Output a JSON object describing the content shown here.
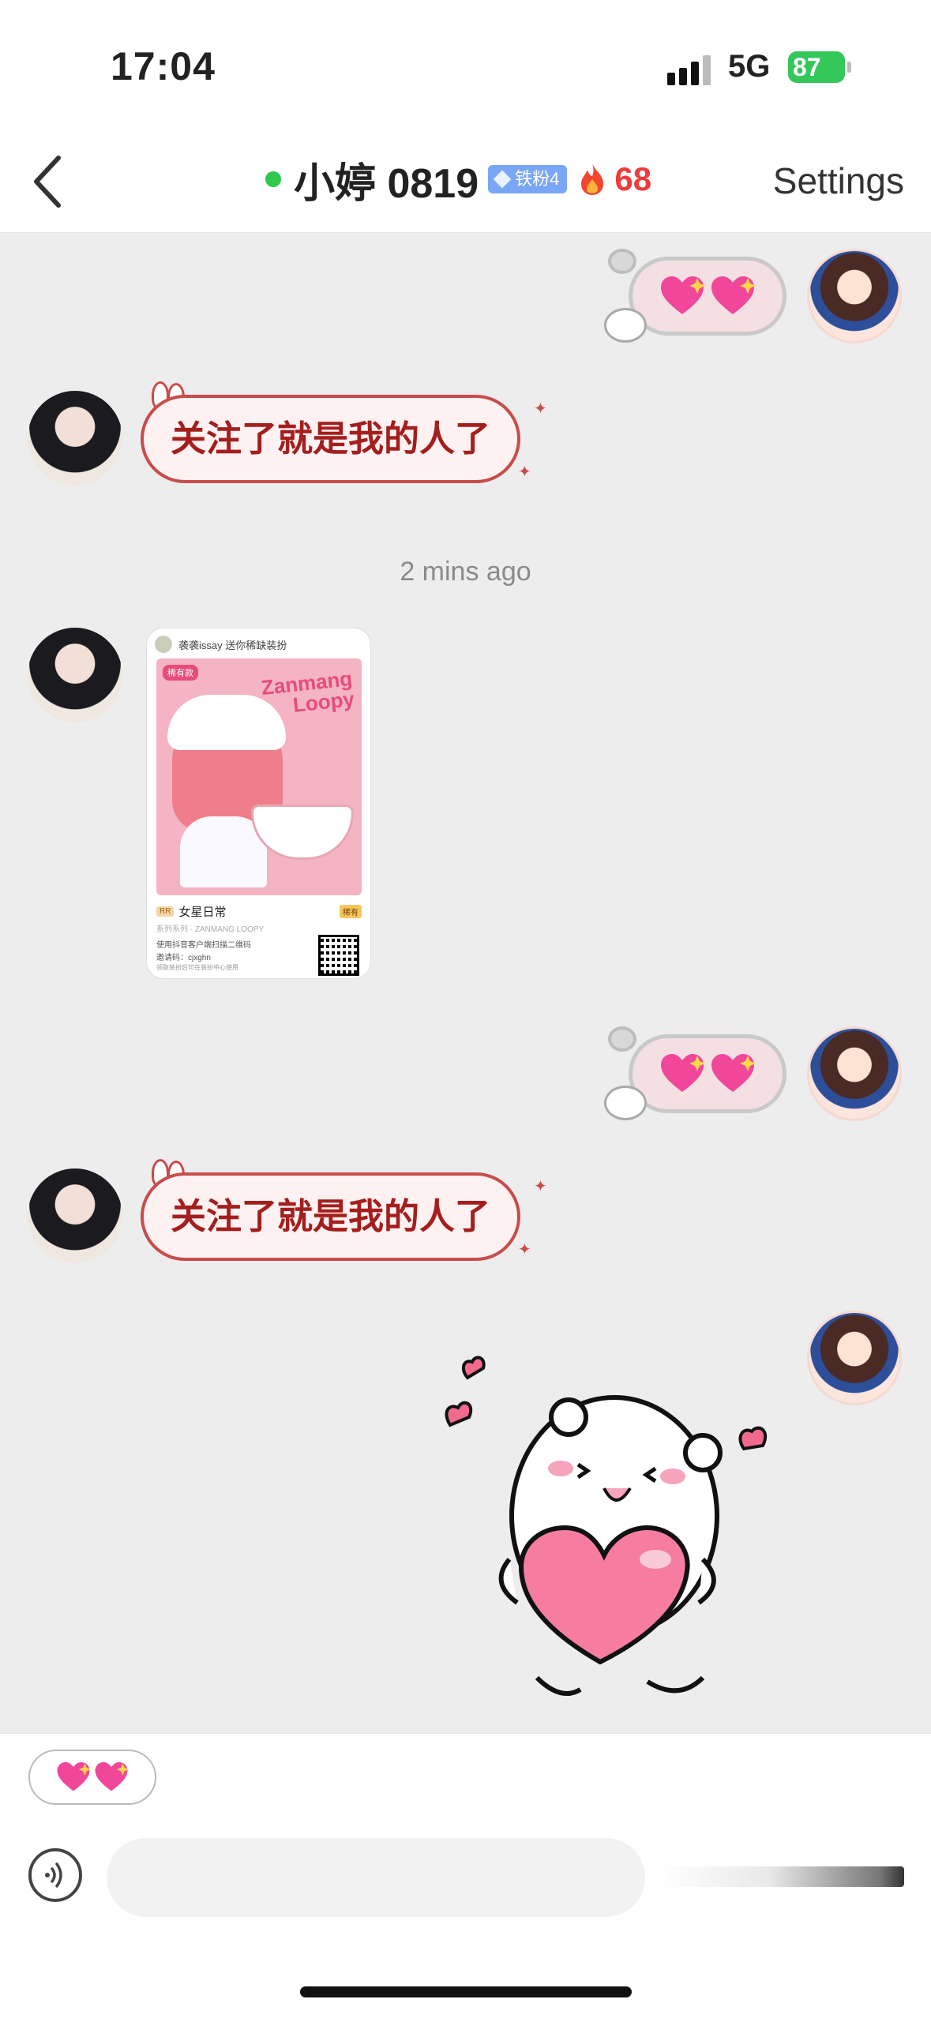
{
  "status_bar": {
    "time": "17:04",
    "network": "5G",
    "battery": "87"
  },
  "header": {
    "back_icon": "chevron-left-icon",
    "title": "小婷 0819",
    "fan_badge": "铁粉4",
    "streak_icon": "fire-icon",
    "streak": "68",
    "settings_label": "Settings",
    "online_color": "#2fc84d"
  },
  "messages": [
    {
      "side": "right",
      "type": "sticker",
      "content": "sparkling-hearts-sticker"
    },
    {
      "side": "left",
      "type": "text",
      "text": "关注了就是我的人了"
    },
    {
      "type": "timestamp",
      "text": "2 mins ago"
    },
    {
      "side": "left",
      "type": "card",
      "card": {
        "header": "袭袭issay 送你稀缺装扮",
        "tag": "稀有款",
        "brand_line1": "Zanmang",
        "brand_line2": "Loopy",
        "type_pill": "RR",
        "name": "女星日常",
        "rarity": "稀有",
        "series": "系列系列 · ZANMANG LOOPY",
        "line1": "使用抖音客户端扫描二维码",
        "line2": "邀请码：cjxghn",
        "line3": "领取装扮后可在装扮中心使用"
      }
    },
    {
      "side": "right",
      "type": "sticker",
      "content": "sparkling-hearts-sticker"
    },
    {
      "side": "left",
      "type": "text",
      "text": "关注了就是我的人了"
    },
    {
      "side": "right",
      "type": "sticker",
      "content": "bear-hugging-heart-sticker"
    }
  ],
  "input_bar": {
    "quick_reply": "sparkling-hearts",
    "voice_icon": "voice-icon",
    "placeholder": ""
  },
  "colors": {
    "chat_background": "#ededed",
    "bubble_text": "#a41e1e",
    "streak": "#ee3b3b"
  }
}
